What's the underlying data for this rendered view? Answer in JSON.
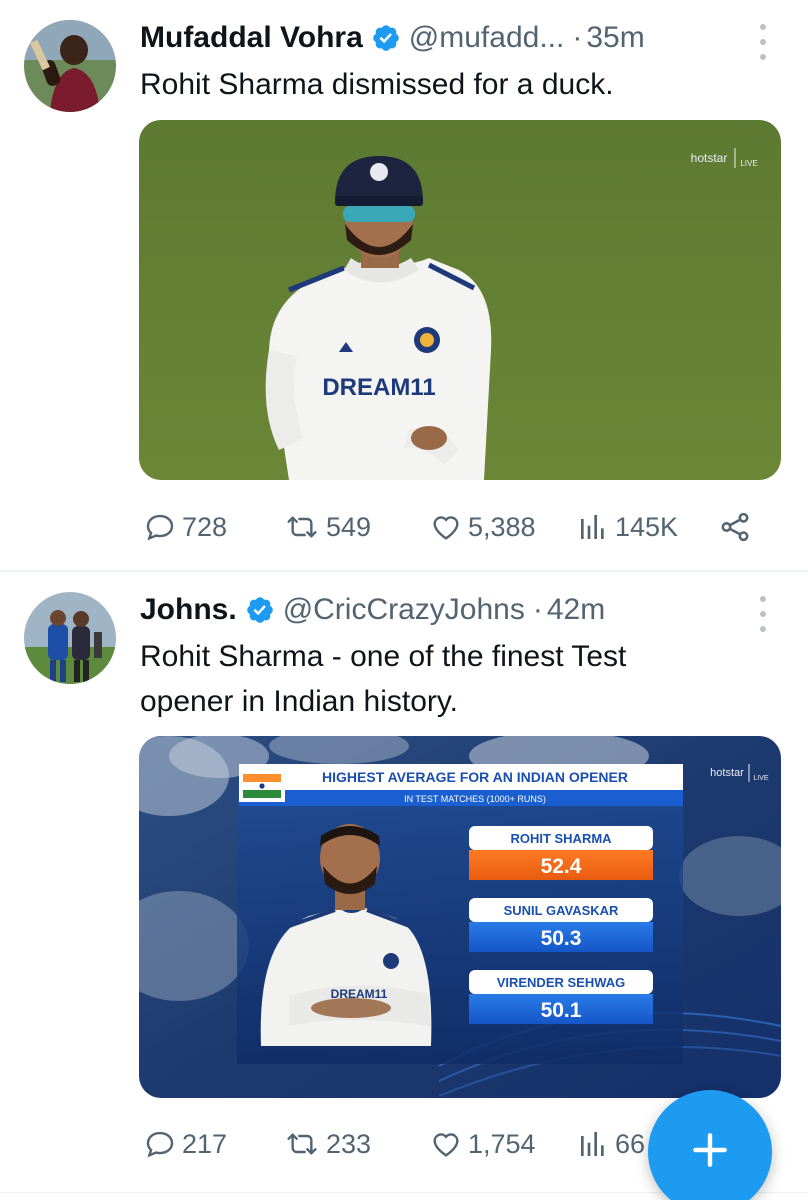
{
  "tweets": [
    {
      "author_name": "Mufaddal Vohra",
      "handle": "@mufadd...",
      "dot": "·",
      "time": "35m",
      "text": "Rohit Sharma dismissed for a duck.",
      "media": {
        "broadcaster": "hotstar",
        "live_tag": "LIVE",
        "jersey_sponsor": "DREAM11"
      },
      "stats": {
        "replies": "728",
        "reposts": "549",
        "likes": "5,388",
        "views": "145K"
      }
    },
    {
      "author_name": "Johns.",
      "handle": "@CricCrazyJohns",
      "dot": "·",
      "time": "42m",
      "text_line1": "Rohit Sharma - one of the finest Test",
      "text_line2": "opener in Indian history.",
      "media": {
        "broadcaster": "hotstar",
        "live_tag": "LIVE",
        "graphic_title": "HIGHEST AVERAGE FOR AN INDIAN OPENER",
        "graphic_subtitle": "IN TEST MATCHES (1000+ RUNS)",
        "players": [
          {
            "name": "ROHIT SHARMA",
            "average": "52.4",
            "highlight": true
          },
          {
            "name": "SUNIL GAVASKAR",
            "average": "50.3",
            "highlight": false
          },
          {
            "name": "VIRENDER SEHWAG",
            "average": "50.1",
            "highlight": false
          }
        ]
      },
      "stats": {
        "replies": "217",
        "reposts": "233",
        "likes": "1,754",
        "views": "66"
      }
    }
  ],
  "colors": {
    "accent": "#1d9bf0",
    "muted": "#536471",
    "highlight_orange": "#f26a1b",
    "graphic_blue": "#1a5fd1"
  },
  "icons": [
    "reply-icon",
    "repost-icon",
    "like-icon",
    "views-icon",
    "share-icon",
    "verified-icon",
    "more-icon",
    "compose-plus-icon"
  ]
}
